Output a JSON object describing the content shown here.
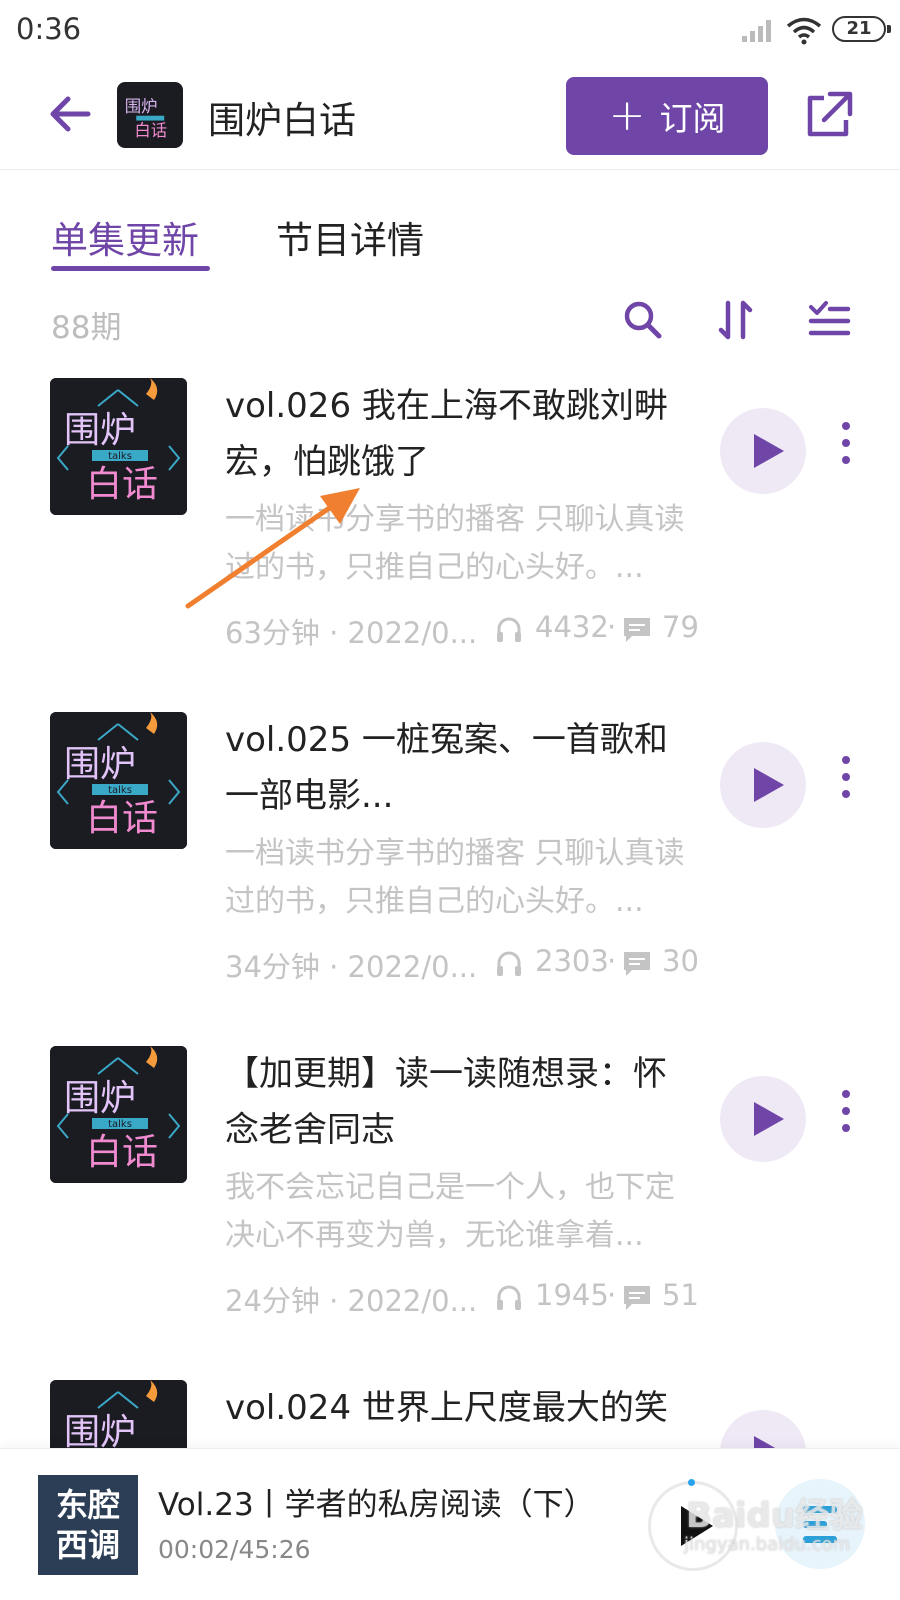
{
  "status_bar": {
    "time": "0:36",
    "battery": "21"
  },
  "header": {
    "title": "围炉白话",
    "subscribe_label": "订阅"
  },
  "tabs": [
    {
      "label": "单集更新",
      "active": true
    },
    {
      "label": "节目详情",
      "active": false
    }
  ],
  "toolbar": {
    "episode_count": "88期"
  },
  "episodes": [
    {
      "title": "vol.026 我在上海不敢跳刘畊宏，怕跳饿了",
      "description": "一档读书分享书的播客 只聊认真读过的书，只推自己的心头好。...",
      "meta": "63分钟 · 2022/0...",
      "plays": "4432",
      "comments": "79"
    },
    {
      "title": "vol.025 一桩冤案、一首歌和一部电影...",
      "description": "一档读书分享书的播客 只聊认真读过的书，只推自己的心头好。...",
      "meta": "34分钟 · 2022/0...",
      "plays": "2303",
      "comments": "30"
    },
    {
      "title": "【加更期】读一读随想录：怀念老舍同志",
      "description": "我不会忘记自己是一个人，也下定决心不再变为兽，无论谁拿着...",
      "meta": "24分钟 · 2022/0...",
      "plays": "1945",
      "comments": "51"
    },
    {
      "title": "vol.024 世界上尺度最大的笑",
      "description": "",
      "meta": "",
      "plays": "",
      "comments": ""
    }
  ],
  "cover_art": {
    "line1": "围炉",
    "line2": "白话",
    "tag": "talks"
  },
  "player": {
    "cover_line1": "东腔",
    "cover_line2": "西调",
    "title": "Vol.23丨学者的私房阅读（下）",
    "time": "00:02/45:26"
  },
  "watermark": {
    "main": "Baidu经验",
    "sub": "jingyan.baidu.com"
  },
  "colors": {
    "accent": "#6f46a8",
    "muted": "#c4c4c4",
    "annotation_arrow": "#f08030"
  }
}
